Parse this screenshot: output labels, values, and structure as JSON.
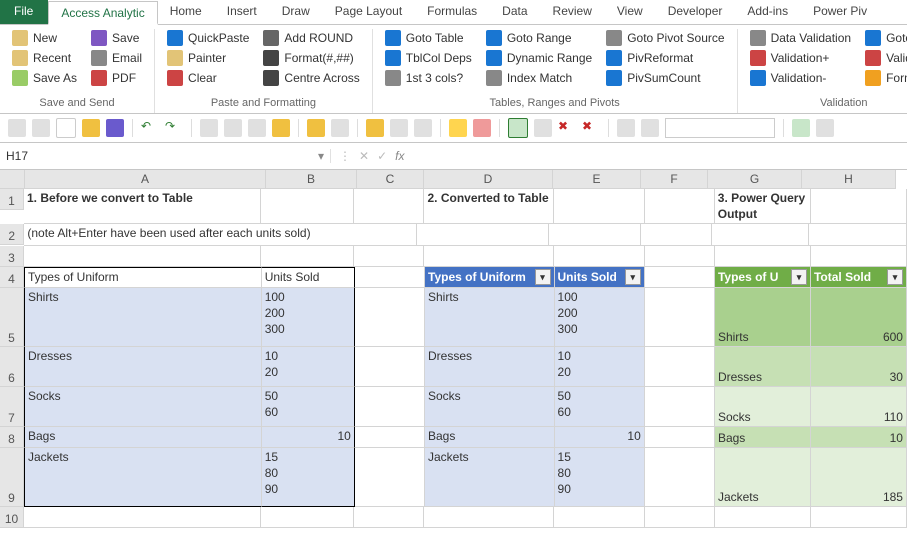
{
  "tabs": [
    "File",
    "Access Analytic",
    "Home",
    "Insert",
    "Draw",
    "Page Layout",
    "Formulas",
    "Data",
    "Review",
    "View",
    "Developer",
    "Add-ins",
    "Power Piv"
  ],
  "groups": {
    "save": {
      "label": "Save and Send",
      "cmds": [
        [
          "New",
          "#e2c477"
        ],
        [
          "Recent",
          "#e2c477"
        ],
        [
          "Save As",
          "#9c6"
        ],
        [
          "Save",
          "#7e57c2"
        ],
        [
          "Email",
          "#888"
        ],
        [
          "PDF",
          "#c44"
        ]
      ]
    },
    "paste": {
      "label": "Paste and Formatting",
      "cmds": [
        [
          "QuickPaste",
          "#1976d2"
        ],
        [
          "Painter",
          "#e2c477"
        ],
        [
          "Clear",
          "#c44"
        ],
        [
          "Add ROUND",
          "#666"
        ],
        [
          "Format(#,##)",
          "#444"
        ],
        [
          "Centre Across",
          "#444"
        ]
      ]
    },
    "tables": {
      "label": "Tables, Ranges and Pivots",
      "cmds": [
        [
          "Goto Table",
          "#1976d2"
        ],
        [
          "TblCol Deps",
          "#1976d2"
        ],
        [
          "1st 3 cols?",
          "#888"
        ],
        [
          "Goto Range",
          "#1976d2"
        ],
        [
          "Dynamic Range",
          "#1976d2"
        ],
        [
          "Index Match",
          "#888"
        ],
        [
          "Goto Pivot Source",
          "#888"
        ],
        [
          "PivReformat",
          "#1976d2"
        ],
        [
          "PivSumCount",
          "#1976d2"
        ]
      ]
    },
    "valid": {
      "label": "Validation",
      "cmds": [
        [
          "Data Validation",
          "#888"
        ],
        [
          "Validation+",
          "#c44"
        ],
        [
          "Validation-",
          "#1976d2"
        ],
        [
          "Goto Vali",
          "#1976d2"
        ],
        [
          "Validation",
          "#c44"
        ],
        [
          "Format n",
          "#f0a020"
        ]
      ]
    }
  },
  "namebox": "H17",
  "headers": [
    "A",
    "B",
    "C",
    "D",
    "E",
    "F",
    "G",
    "H"
  ],
  "t1": {
    "title": "1. Before we convert to Table",
    "note": "(note Alt+Enter have been used after each units sold)",
    "hA": "Types of Uniform",
    "hB": "Units Sold",
    "rows": [
      {
        "a": "Shirts",
        "b": "100\n200\n300",
        "lines": 3
      },
      {
        "a": "Dresses",
        "b": "10\n20",
        "lines": 2
      },
      {
        "a": "Socks",
        "b": "50\n60",
        "lines": 2
      },
      {
        "a": "Bags",
        "b": "10",
        "lines": 1,
        "right": true
      },
      {
        "a": "Jackets",
        "b": "15\n80\n90",
        "lines": 3
      }
    ]
  },
  "t2": {
    "title": "2. Converted to Table",
    "hD": "Types of Uniform",
    "hE": "Units Sold"
  },
  "t3": {
    "title": "3. Power Query Output",
    "hG": "Types of U",
    "hH": "Total Sold",
    "rows": [
      {
        "g": "Shirts",
        "h": "600"
      },
      {
        "g": "Dresses",
        "h": "30"
      },
      {
        "g": "Socks",
        "h": "110"
      },
      {
        "g": "Bags",
        "h": "10"
      },
      {
        "g": "Jackets",
        "h": "185"
      }
    ]
  }
}
